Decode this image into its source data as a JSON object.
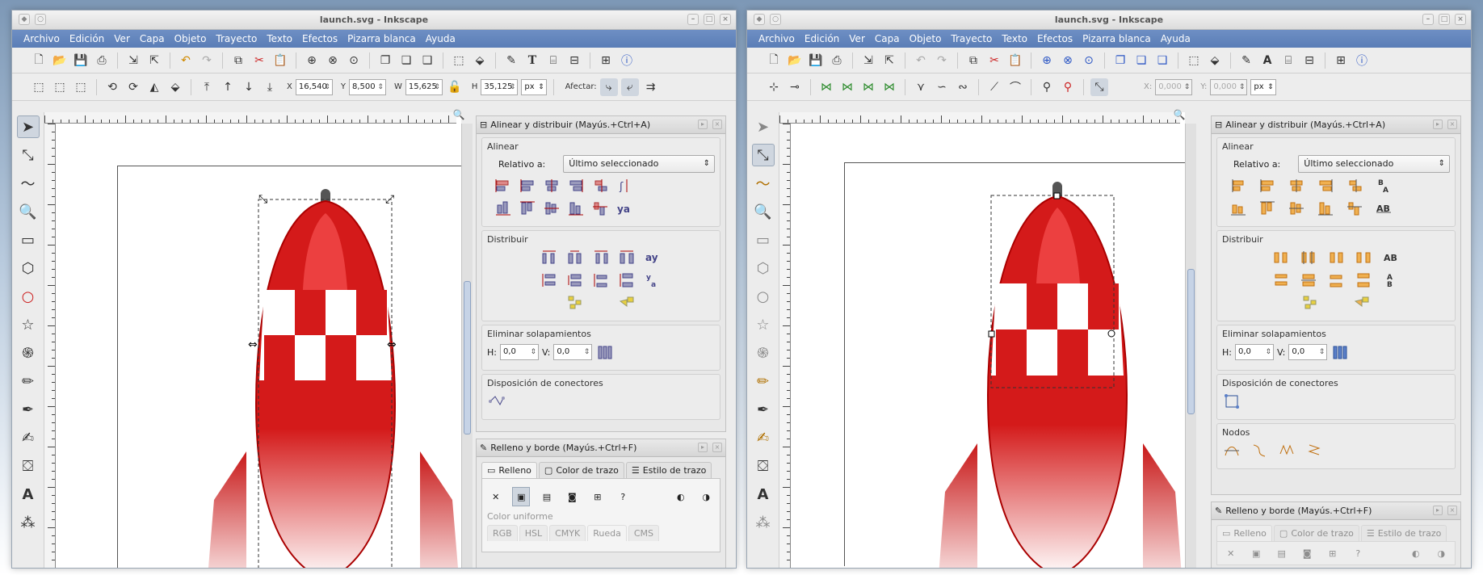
{
  "left_window": {
    "title": "launch.svg - Inkscape",
    "menu": [
      "Archivo",
      "Edición",
      "Ver",
      "Capa",
      "Objeto",
      "Trayecto",
      "Texto",
      "Efectos",
      "Pizarra blanca",
      "Ayuda"
    ],
    "controls": {
      "x_label": "X",
      "x_value": "16,540",
      "y_label": "Y",
      "y_value": "8,500",
      "w_label": "W",
      "w_value": "15,625",
      "h_label": "H",
      "h_value": "35,125",
      "unit": "px",
      "affect_label": "Afectar:"
    },
    "align_panel": {
      "title": "Alinear y distribuir (Mayús.+Ctrl+A)",
      "align_label": "Alinear",
      "relative_label": "Relativo a:",
      "relative_value": "Último seleccionado",
      "distribute_label": "Distribuir",
      "overlap_label": "Eliminar solapamientos",
      "h_label": "H:",
      "h_value": "0,0",
      "v_label": "V:",
      "v_value": "0,0",
      "connector_label": "Disposición de conectores"
    },
    "fill_panel": {
      "title": "Relleno y borde (Mayús.+Ctrl+F)",
      "tabs": [
        "Relleno",
        "Color de trazo",
        "Estilo de trazo"
      ],
      "flat_label": "Color uniforme",
      "modes": [
        "RGB",
        "HSL",
        "CMYK",
        "Rueda",
        "CMS"
      ]
    }
  },
  "right_window": {
    "title": "launch.svg - Inkscape",
    "menu": [
      "Archivo",
      "Edición",
      "Ver",
      "Capa",
      "Objeto",
      "Trayecto",
      "Texto",
      "Efectos",
      "Pizarra blanca",
      "Ayuda"
    ],
    "controls": {
      "x_label": "X:",
      "x_value": "0,000",
      "y_label": "Y:",
      "y_value": "0,000",
      "unit": "px"
    },
    "align_panel": {
      "title": "Alinear y distribuir (Mayús.+Ctrl+A)",
      "align_label": "Alinear",
      "relative_label": "Relativo a:",
      "relative_value": "Último seleccionado",
      "distribute_label": "Distribuir",
      "overlap_label": "Eliminar solapamientos",
      "h_label": "H:",
      "h_value": "0,0",
      "v_label": "V:",
      "v_value": "0,0",
      "connector_label": "Disposición de conectores",
      "nodes_label": "Nodos"
    },
    "fill_panel": {
      "title": "Relleno y borde (Mayús.+Ctrl+F)",
      "tabs": [
        "Relleno",
        "Color de trazo",
        "Estilo de trazo"
      ]
    }
  },
  "colors": {
    "menubar": "#5f82bb",
    "rocket_red": "#d41a1a",
    "accent_orange": "#e08a1e"
  }
}
